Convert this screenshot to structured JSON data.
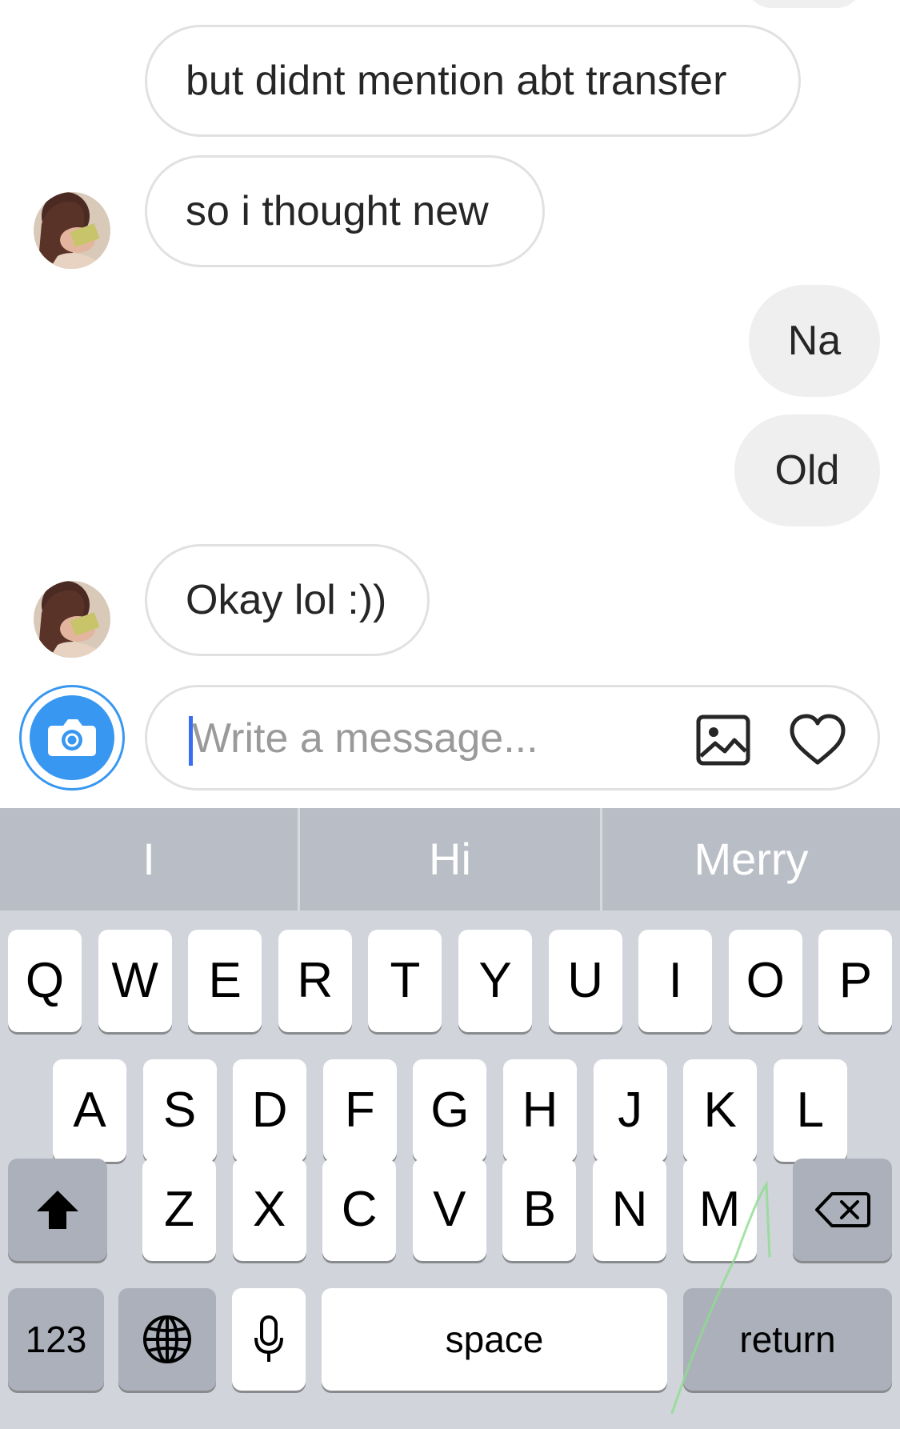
{
  "colors": {
    "accent": "#3897f0",
    "caret": "#3b6cf6",
    "outgoing_bubble": "#efefef",
    "keyboard_bg": "#d1d5db"
  },
  "messages": [
    {
      "text": "but didnt mention abt transfer",
      "direction": "incoming",
      "avatar": false
    },
    {
      "text": "so i thought new",
      "direction": "incoming",
      "avatar": true
    },
    {
      "text": "Na",
      "direction": "outgoing"
    },
    {
      "text": "Old",
      "direction": "outgoing"
    },
    {
      "text": "Okay lol :))",
      "direction": "incoming",
      "avatar": true
    }
  ],
  "composer": {
    "placeholder": "Write a message...",
    "icons": [
      "camera-icon",
      "gallery-icon",
      "heart-icon"
    ]
  },
  "keyboard": {
    "suggestions": [
      "I",
      "Hi",
      "Merry"
    ],
    "row1": [
      "Q",
      "W",
      "E",
      "R",
      "T",
      "Y",
      "U",
      "I",
      "O",
      "P"
    ],
    "row2": [
      "A",
      "S",
      "D",
      "F",
      "G",
      "H",
      "J",
      "K",
      "L"
    ],
    "row3": [
      "Z",
      "X",
      "C",
      "V",
      "B",
      "N",
      "M"
    ],
    "numbers_label": "123",
    "space_label": "space",
    "return_label": "return",
    "icons": [
      "shift-icon",
      "backspace-icon",
      "globe-icon",
      "microphone-icon"
    ]
  }
}
